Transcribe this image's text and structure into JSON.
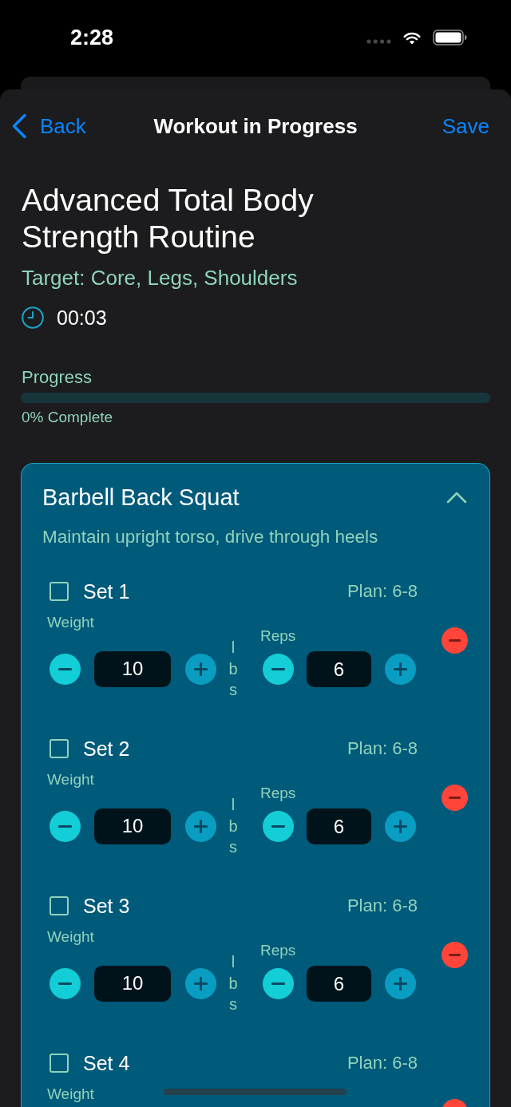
{
  "status_bar": {
    "time": "2:28"
  },
  "nav_bar": {
    "back": "Back",
    "title": "Workout in Progress",
    "save": "Save"
  },
  "workout": {
    "title": "Advanced Total Body Strength Routine",
    "target": "Target: Core, Legs, Shoulders",
    "timer": "00:03",
    "progress": {
      "label": "Progress",
      "level": 0,
      "caption": "0% Complete"
    }
  },
  "exercises": [
    {
      "name": "Barbell Back Squat",
      "expanded": true,
      "note": "Maintain upright torso, drive through heels",
      "sets": [
        {
          "label": "Set 1",
          "checked": false,
          "plan": "Plan: 6-8",
          "weight_label": "Weight",
          "weight": "10",
          "unit": "lbs",
          "reps_label": "Reps",
          "reps": "6"
        },
        {
          "label": "Set 2",
          "checked": false,
          "plan": "Plan: 6-8",
          "weight_label": "Weight",
          "weight": "10",
          "unit": "lbs",
          "reps_label": "Reps",
          "reps": "6"
        },
        {
          "label": "Set 3",
          "checked": false,
          "plan": "Plan: 6-8",
          "weight_label": "Weight",
          "weight": "10",
          "unit": "lbs",
          "reps_label": "Reps",
          "reps": "6"
        },
        {
          "label": "Set 4",
          "checked": false,
          "plan": "Plan: 6-8",
          "weight_label": "Weight"
        }
      ]
    }
  ]
}
